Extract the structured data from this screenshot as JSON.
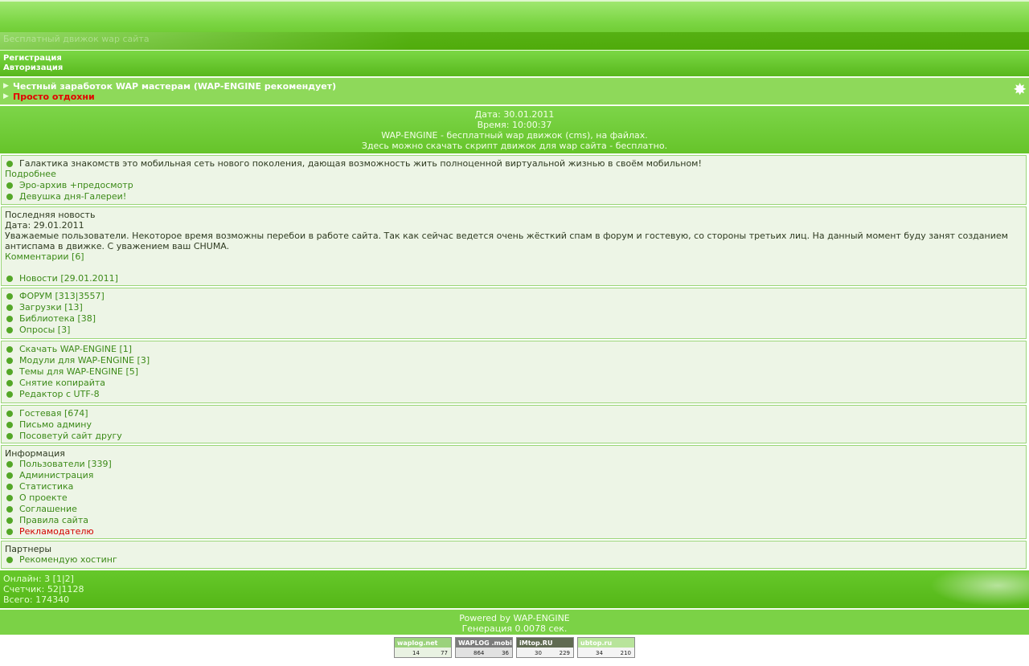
{
  "header": {
    "site_title": "Бесплатный движок wap сайта"
  },
  "auth": {
    "register": "Регистрация",
    "login": "Авторизация"
  },
  "promo": {
    "link1": "Честный заработок WAP мастерам (WAP-ENGINE рекомендует)",
    "link2": "Просто отдохни"
  },
  "info": {
    "date": "Дата: 30.01.2011",
    "time": "Время: 10:00:37",
    "tagline": "WAP-ENGINE - бесплатный wap движок (cms), на файлах.",
    "download": "Здесь можно скачать скрипт движок для wap сайта - бесплатно."
  },
  "block1": {
    "galaxy": "Галактика знакомств это мобильная сеть нового поколения, дающая возможность жить полноценной виртуальной жизнью в своём мобильном!",
    "more": "Подробнее",
    "ero": "Эро-архив +предосмотр",
    "girl": "Девушка дня-Галереи!"
  },
  "news": {
    "heading": "Последняя новость",
    "date": "Дата: 29.01.2011",
    "text": "Уважаемые пользователи. Некоторое время возможны перебои в работе сайта. Так как сейчас ведется очень жёсткий спам в форум и гостевую, со стороны третьих лиц. На данный момент буду занят созданием антиспама в движке. С уважением ваш CHUMA.",
    "comments": "Комментарии [6]",
    "news_link": "Новости [29.01.2011]"
  },
  "sections": [
    "ФОРУМ [313|3557]",
    "Загрузки [13]",
    "Библиотека [38]",
    "Опросы [3]"
  ],
  "engine": [
    "Скачать WAP-ENGINE [1]",
    "Модули для WAP-ENGINE [3]",
    "Темы для WAP-ENGINE [5]",
    "Снятие копирайта",
    "Редактор с UTF-8"
  ],
  "guest": [
    "Гостевая [674]",
    "Письмо админу",
    "Посоветуй сайт другу"
  ],
  "information": {
    "heading": "Информация",
    "items": [
      "Пользователи [339]",
      "Администрация",
      "Статистика",
      "О проекте",
      "Соглашение",
      "Правила сайта"
    ],
    "advertiser": "Рекламодателю"
  },
  "partners": {
    "heading": "Партнеры",
    "hosting": "Рекомендую хостинг"
  },
  "stats": {
    "online": "Онлайн: 3 [1|2]",
    "counter": "Счетчик: 52|1128",
    "total": "Всего: 174340"
  },
  "powered": {
    "by": "Powered by WAP-ENGINE",
    "gen": "Генерация 0.0078 сек."
  },
  "counters": [
    {
      "name": "waplog.net",
      "a": "14",
      "b": "77"
    },
    {
      "name": "WAPLOG .mobi",
      "a": "864",
      "b": "36"
    },
    {
      "name": "iMtop.RU",
      "a": "30",
      "b": "229"
    },
    {
      "name": "ubtop.ru",
      "a": "34",
      "b": "210"
    }
  ],
  "colors": {
    "green_main": "#6ac72e",
    "link": "#3c8a18",
    "red": "#d40000"
  }
}
